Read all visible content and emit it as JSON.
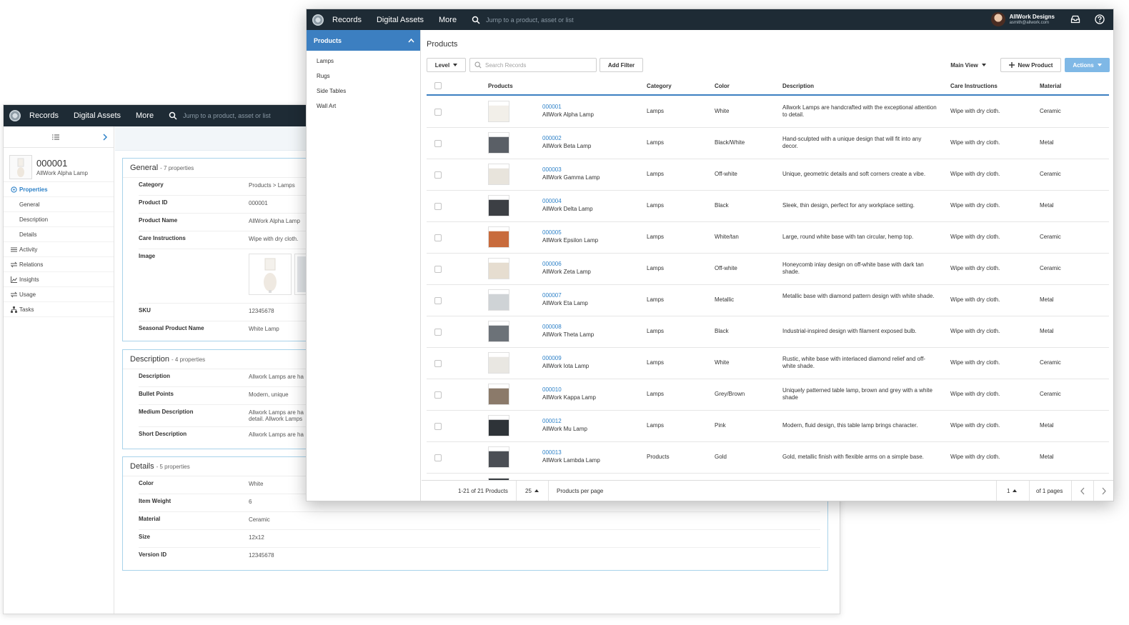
{
  "nav": {
    "records": "Records",
    "digital_assets": "Digital Assets",
    "more": "More",
    "search_placeholder": "Jump to a product, asset or list"
  },
  "user": {
    "company": "AllWork Designs",
    "email": "asmith@allwork.com"
  },
  "icons": [
    "logo-icon",
    "search-icon",
    "inbox-icon",
    "help-icon",
    "list-icon",
    "chevron-right-icon",
    "chevron-up-icon",
    "properties-icon",
    "activity-icon",
    "relations-icon",
    "insights-icon",
    "usage-icon",
    "tasks-icon",
    "plus-icon",
    "chevron-left-icon"
  ],
  "record": {
    "id": "000001",
    "name": "AllWork Alpha Lamp",
    "nav": {
      "properties": "Properties",
      "general": "General",
      "description": "Description",
      "details": "Details",
      "activity": "Activity",
      "relations": "Relations",
      "insights": "Insights",
      "usage": "Usage",
      "tasks": "Tasks"
    },
    "general": {
      "title": "General",
      "count": "- 7 properties",
      "props": [
        {
          "label": "Category",
          "value": "Products > Lamps"
        },
        {
          "label": "Product ID",
          "value": "000001"
        },
        {
          "label": "Product Name",
          "value": "AllWork Alpha Lamp"
        },
        {
          "label": "Care Instructions",
          "value": "Wipe with dry cloth."
        },
        {
          "label": "Image",
          "value": ""
        },
        {
          "label": "SKU",
          "value": "12345678"
        },
        {
          "label": "Seasonal Product Name",
          "value": "White Lamp"
        }
      ]
    },
    "description": {
      "title": "Description",
      "count": "- 4 properties",
      "props": [
        {
          "label": "Description",
          "value": "Allwork Lamps are ha"
        },
        {
          "label": "Bullet Points",
          "value": "Modern, unique"
        },
        {
          "label": "Medium Description",
          "value": "Allwork Lamps are ha",
          "value2": "detail. Allwork Lamps"
        },
        {
          "label": "Short Description",
          "value": "Allwork Lamps are ha"
        }
      ]
    },
    "details": {
      "title": "Details",
      "count": "- 5 properties",
      "props": [
        {
          "label": "Color",
          "value": "White"
        },
        {
          "label": "Item Weight",
          "value": "6"
        },
        {
          "label": "Material",
          "value": "Ceramic"
        },
        {
          "label": "Size",
          "value": "12x12"
        },
        {
          "label": "Version ID",
          "value": "12345678"
        }
      ]
    }
  },
  "sidebar": {
    "header": "Products",
    "items": [
      "Lamps",
      "Rugs",
      "Side Tables",
      "Wall Art"
    ]
  },
  "products": {
    "title": "Products",
    "level_label": "Level",
    "search_placeholder": "Search Records",
    "add_filter": "Add Filter",
    "view_label": "Main View",
    "new_product": "New Product",
    "actions": "Actions",
    "columns": {
      "products": "Products",
      "category": "Category",
      "color": "Color",
      "description": "Description",
      "care": "Care Instructions",
      "material": "Material"
    },
    "rows": [
      {
        "id": "000001",
        "name": "AllWork Alpha Lamp",
        "category": "Lamps",
        "color": "White",
        "description": "Allwork Lamps are handcrafted with the exceptional attention to detail.",
        "care": "Wipe with dry cloth.",
        "material": "Ceramic"
      },
      {
        "id": "000002",
        "name": "AllWork Beta Lamp",
        "category": "Lamps",
        "color": "Black/White",
        "description": "Hand-sculpted with a unique design that will fit into any decor.",
        "care": "Wipe with dry cloth.",
        "material": "Metal"
      },
      {
        "id": "000003",
        "name": "AllWork Gamma Lamp",
        "category": "Lamps",
        "color": "Off-white",
        "description": "Unique, geometric details and soft corners create a vibe.",
        "care": "Wipe with dry cloth.",
        "material": "Ceramic"
      },
      {
        "id": "000004",
        "name": "AllWork Delta Lamp",
        "category": "Lamps",
        "color": "Black",
        "description": "Sleek, thin design, perfect for any workplace setting.",
        "care": "Wipe with dry cloth.",
        "material": "Metal"
      },
      {
        "id": "000005",
        "name": "AllWork Epsilon Lamp",
        "category": "Lamps",
        "color": "White/tan",
        "description": "Large, round white base with tan circular, hemp top.",
        "care": "Wipe with dry cloth.",
        "material": "Ceramic"
      },
      {
        "id": "000006",
        "name": "AllWork Zeta Lamp",
        "category": "Lamps",
        "color": "Off-white",
        "description": "Honeycomb inlay design on off-white base with dark tan shade.",
        "care": "Wipe with dry cloth.",
        "material": "Ceramic"
      },
      {
        "id": "000007",
        "name": "AllWork Eta Lamp",
        "category": "Lamps",
        "color": "Metallic",
        "description": "Metallic base with diamond pattern design with white shade.",
        "care": "Wipe with dry cloth.",
        "material": "Metal"
      },
      {
        "id": "000008",
        "name": "AllWork Theta Lamp",
        "category": "Lamps",
        "color": "Black",
        "description": "Industrial-inspired design with filament exposed bulb.",
        "care": "Wipe with dry cloth.",
        "material": "Metal"
      },
      {
        "id": "000009",
        "name": "AllWork Iota Lamp",
        "category": "Lamps",
        "color": "White",
        "description": "Rustic, white base with interlaced diamond relief and off-white shade.",
        "care": "Wipe with dry cloth.",
        "material": "Ceramic"
      },
      {
        "id": "000010",
        "name": "AllWork Kappa Lamp",
        "category": "Lamps",
        "color": "Grey/Brown",
        "description": "Uniquely patterned table lamp, brown and grey with a white shade",
        "care": "Wipe with dry cloth.",
        "material": "Ceramic"
      },
      {
        "id": "000012",
        "name": "AllWork Mu Lamp",
        "category": "Lamps",
        "color": "Pink",
        "description": "Modern, fluid design, this table lamp brings character.",
        "care": "Wipe with dry cloth.",
        "material": "Metal"
      },
      {
        "id": "000013",
        "name": "AllWork Lambda Lamp",
        "category": "Products",
        "color": "Gold",
        "description": "Gold, metallic finish with flexible arms on a simple base.",
        "care": "Wipe with dry cloth.",
        "material": "Metal"
      }
    ],
    "pager": {
      "range": "1-21 of 21 Products",
      "per_page": "25",
      "per_page_label": "Products per page",
      "page": "1",
      "of_pages": "of 1 pages"
    }
  },
  "colors": {
    "topbar": "#1e2b35",
    "accent": "#3c7fc1",
    "link": "#2f82c8",
    "section_border": "#a9d3ea"
  }
}
